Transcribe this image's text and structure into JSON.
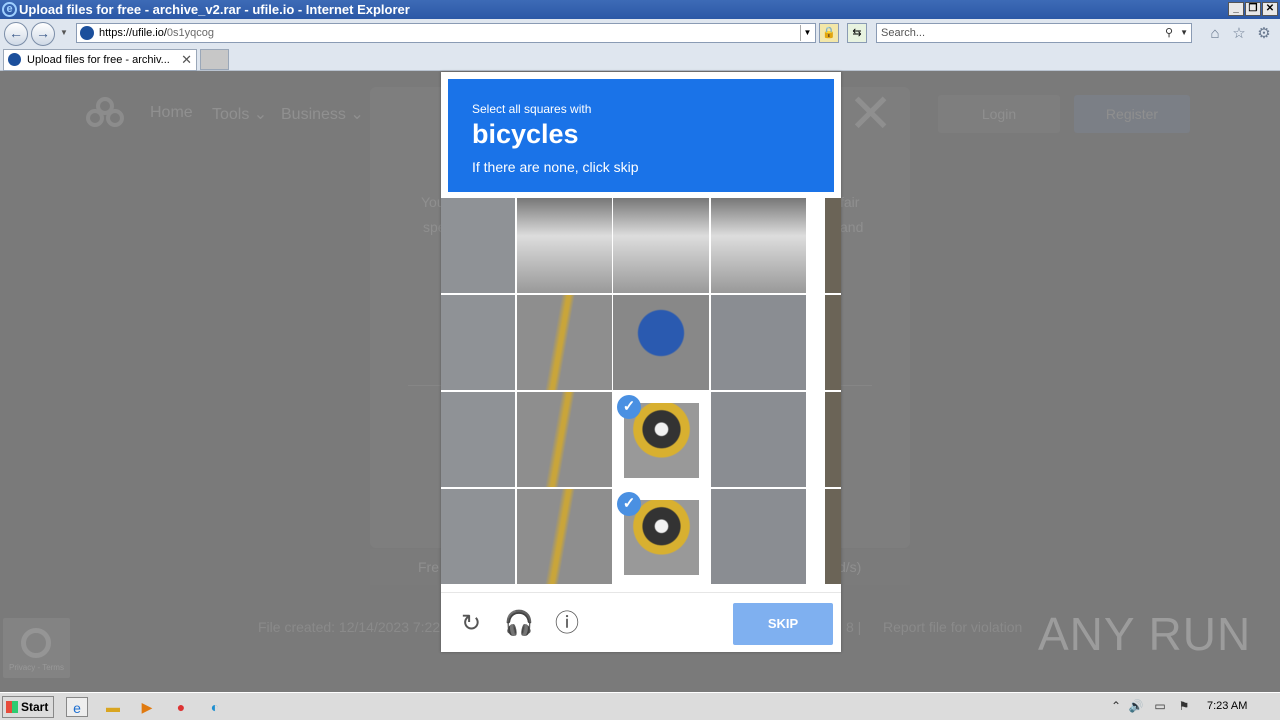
{
  "window": {
    "title": "Upload files for free - archive_v2.rar - ufile.io - Internet Explorer",
    "controls": [
      "_",
      "❐",
      "✕"
    ]
  },
  "address_bar": {
    "url_host": "https://ufile.io/",
    "url_path": "0s1yqcog",
    "search_placeholder": "Search..."
  },
  "tabs": [
    {
      "title": "Upload files for free - archiv...",
      "close": "✕"
    }
  ],
  "site": {
    "nav": [
      "Home",
      "Tools ⌄",
      "Business ⌄"
    ],
    "login": "Login",
    "register": "Register",
    "modal_text_left": [
      "You",
      "spe"
    ],
    "modal_text_right": [
      "fair",
      "and"
    ],
    "strip_left": "Fre",
    "strip_right": "d/s)",
    "file_created": "File created: 12/14/2023 7:22",
    "report_sep": "8   |",
    "report": "Report file for violation",
    "recaptcha_badge": "Privacy - Terms"
  },
  "captcha": {
    "instruction": "Select all squares with",
    "target": "bicycles",
    "hint": "If there are none, click skip",
    "skip_label": "SKIP",
    "tiles": [
      [
        false,
        false,
        false,
        false
      ],
      [
        false,
        false,
        false,
        false
      ],
      [
        false,
        false,
        true,
        false
      ],
      [
        false,
        false,
        true,
        false
      ]
    ],
    "icons": [
      "reload-icon",
      "audio-icon",
      "info-icon"
    ]
  },
  "watermark": "ANY RUN",
  "taskbar": {
    "start": "Start",
    "clock": "7:23 AM"
  }
}
